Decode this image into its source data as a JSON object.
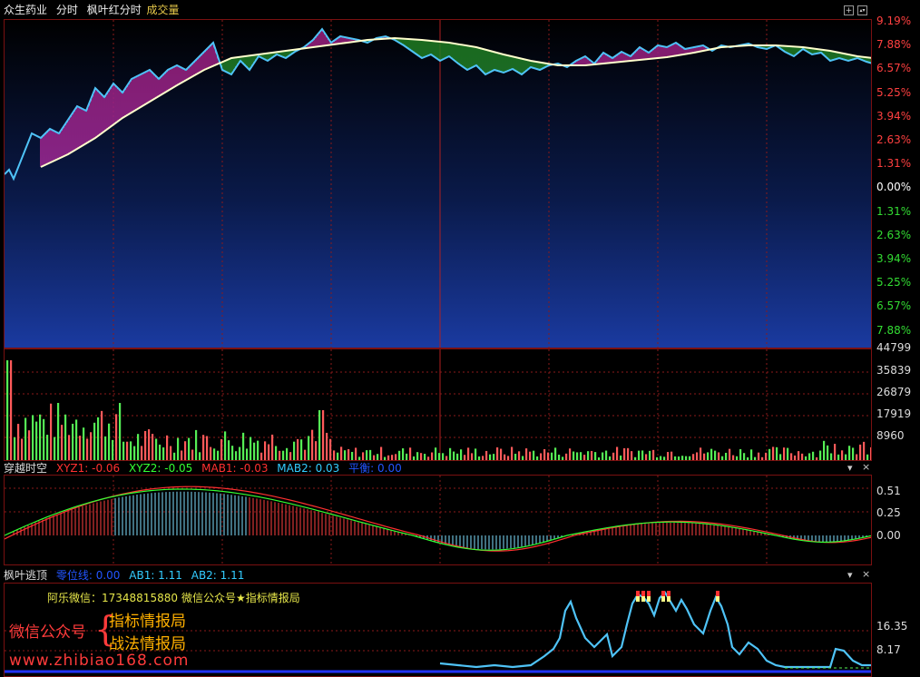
{
  "header": {
    "stock_name": "众生药业",
    "mode": "分时",
    "indicator_name": "枫叶红分时",
    "volume_label": "成交量"
  },
  "main_axis": {
    "labels": [
      "9.19%",
      "7.88%",
      "6.57%",
      "5.25%",
      "3.94%",
      "2.63%",
      "1.31%",
      "0.00%",
      "1.31%",
      "2.63%",
      "3.94%",
      "5.25%",
      "6.57%",
      "7.88%"
    ],
    "colors": [
      "#ff4040",
      "#ff4040",
      "#ff4040",
      "#ff4040",
      "#ff4040",
      "#ff4040",
      "#ff4040",
      "#ffffff",
      "#33dd33",
      "#33dd33",
      "#33dd33",
      "#33dd33",
      "#33dd33",
      "#33dd33"
    ]
  },
  "volume_axis": {
    "labels": [
      "44799",
      "35839",
      "26879",
      "17919",
      "8960"
    ]
  },
  "panel2": {
    "title": "穿越时空",
    "xyz1_label": "XYZ1: -0.06",
    "xyz2_label": "XYZ2: -0.05",
    "mab1_label": "MAB1: -0.03",
    "mab2_label": "MAB2: 0.03",
    "zero_label": "平衡: 0.00",
    "axis": [
      "0.51",
      "0.25",
      "0.00"
    ]
  },
  "panel3": {
    "title": "枫叶逃顶",
    "zero_label": "零位线: 0.00",
    "ab1_label": "AB1: 1.11",
    "ab2_label": "AB2: 1.11",
    "contact": "阿乐微信：17348815880",
    "wechat_notice": "微信公众号★指标情报局",
    "watermark_prefix": "微信公众号",
    "watermark_line1": "指标情报局",
    "watermark_line2": "战法情报局",
    "url": "www.zhibiao168.com",
    "axis": [
      "16.35",
      "8.17"
    ]
  },
  "controls": {
    "expand": "+",
    "scroll": "▴▾",
    "menu": "▾",
    "close": "×"
  },
  "colors": {
    "price": "#4fc3f7",
    "avg": "#ffffcc",
    "up_fill": "#ff33cc",
    "down_fill": "#33cc33",
    "grid": "#8b1a1a",
    "xyz1": "#ff3030",
    "xyz2": "#33ff33",
    "mab1": "#ff3030",
    "mab2": "#33ccff"
  }
}
